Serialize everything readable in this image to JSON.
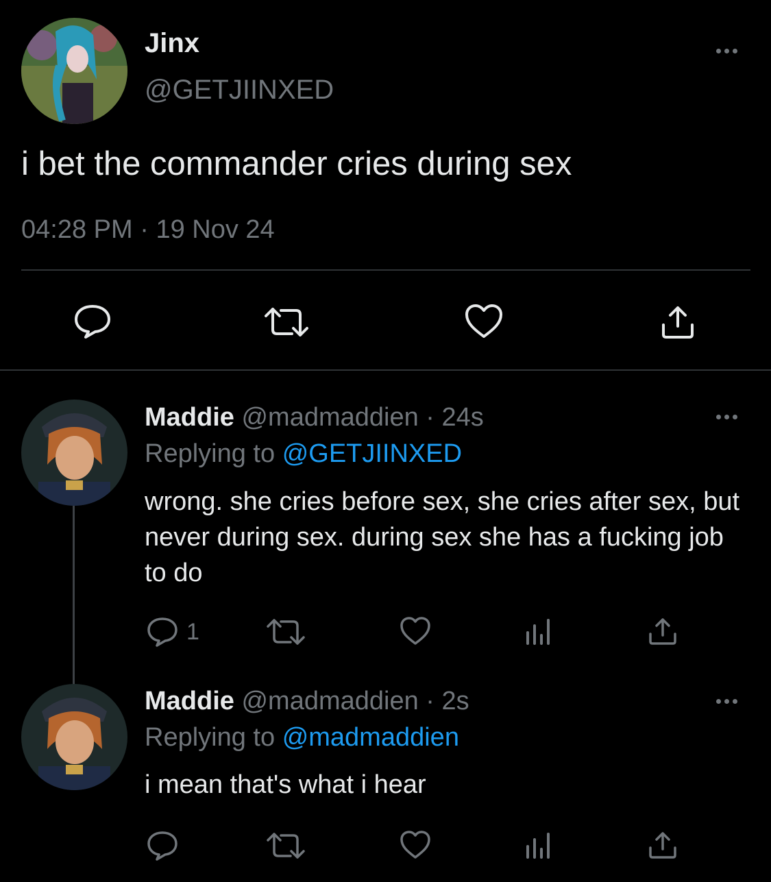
{
  "main_tweet": {
    "display_name": "Jinx",
    "handle": "@GETJIINXED",
    "text": "i bet the commander cries during sex",
    "time": "04:28 PM",
    "separator": "·",
    "date": "19 Nov 24"
  },
  "replies": [
    {
      "display_name": "Maddie",
      "handle": "@madmaddien",
      "age_separator": "·",
      "age": "24s",
      "replying_to_label": "Replying to",
      "replying_to_handle": "@GETJIINXED",
      "text": "wrong. she cries before sex, she cries after sex, but never during sex. during sex she has a fucking job to do",
      "reply_count": "1"
    },
    {
      "display_name": "Maddie",
      "handle": "@madmaddien",
      "age_separator": "·",
      "age": "2s",
      "replying_to_label": "Replying to",
      "replying_to_handle": "@madmaddien",
      "text": "i mean that's what i hear",
      "reply_count": ""
    }
  ],
  "icons": {
    "reply": "speech-bubble-icon",
    "retweet": "retweet-arrows-icon",
    "like": "heart-icon",
    "share": "share-upload-icon",
    "views": "bar-chart-icon",
    "more": "ellipsis-icon"
  },
  "colors": {
    "background": "#000000",
    "text": "#e7e9ea",
    "muted": "#71767b",
    "link": "#1d9bf0",
    "divider": "#2f3336"
  }
}
